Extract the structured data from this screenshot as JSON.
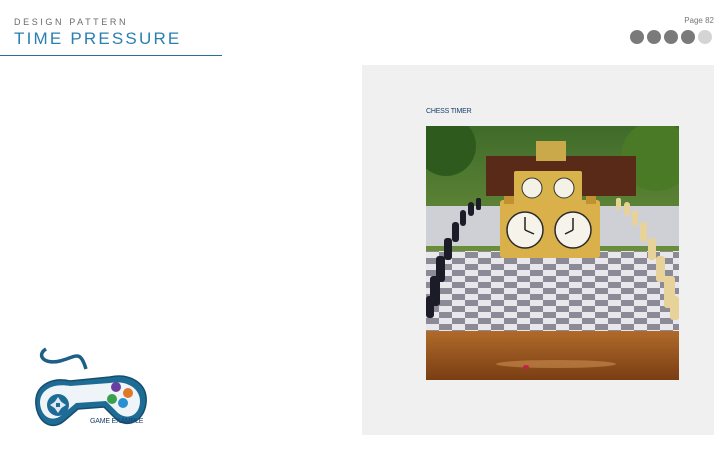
{
  "header": {
    "eyebrow": "DESIGN PATTERN",
    "title": "TIME PRESSURE",
    "page_label": "Page 82"
  },
  "progress": {
    "filled": 4,
    "total": 5
  },
  "figure": {
    "caption": "CHESS TIMER",
    "image_icon": "chess-clock-photo"
  },
  "game_example": {
    "label": "GAME EXAMPLE",
    "icon": "gamepad-icon"
  },
  "colors": {
    "accent": "#2a7fb0",
    "rule": "#2a6f9a",
    "dot_filled": "#7a7a7a",
    "dot_empty": "#d4d4d4",
    "panel_bg": "#f0f0f0"
  }
}
